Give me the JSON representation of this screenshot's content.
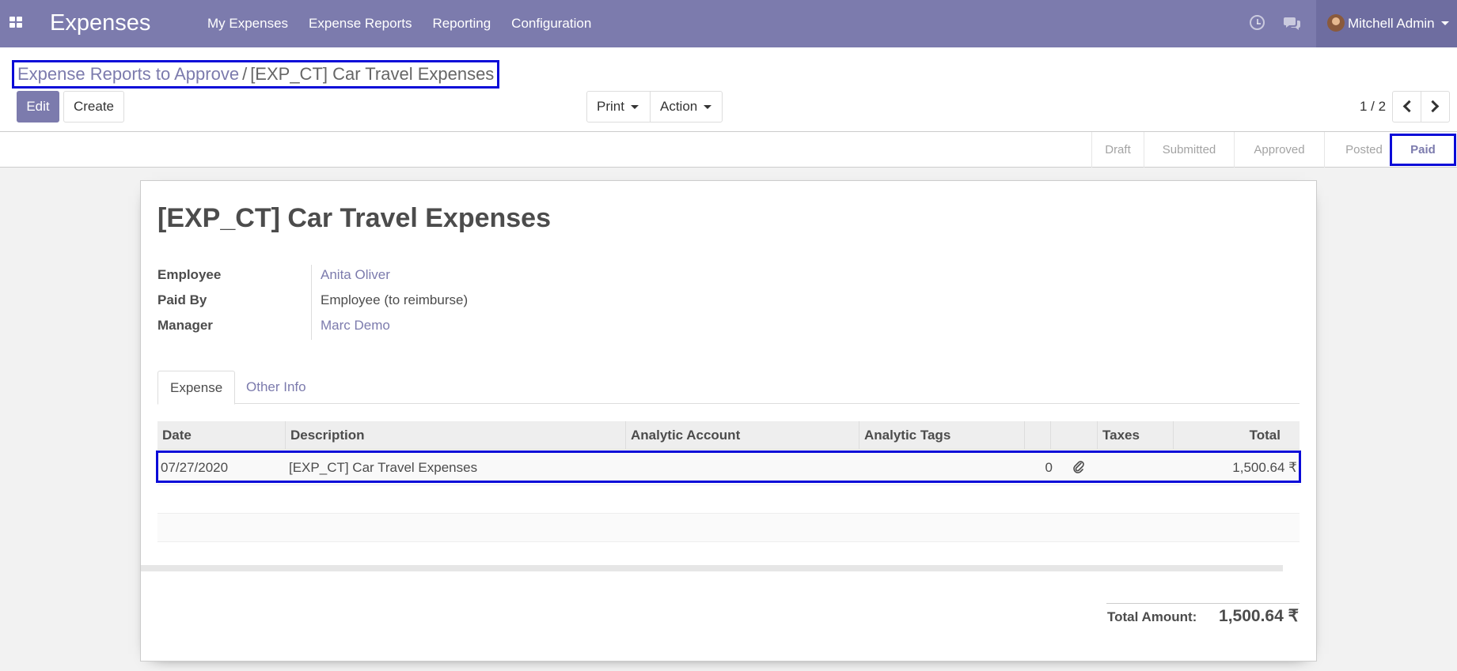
{
  "app": {
    "brand": "Expenses",
    "menu": [
      "My Expenses",
      "Expense Reports",
      "Reporting",
      "Configuration"
    ],
    "user": "Mitchell Admin",
    "accent_color": "#7c7bad"
  },
  "breadcrumb": {
    "parent": "Expense Reports to Approve",
    "separator": "/",
    "current": "[EXP_CT] Car Travel Expenses"
  },
  "buttons": {
    "edit": "Edit",
    "create": "Create",
    "print": "Print",
    "action": "Action"
  },
  "pager": {
    "text": "1 / 2"
  },
  "statusbar": {
    "stages": [
      "Draft",
      "Submitted",
      "Approved",
      "Posted",
      "Paid"
    ],
    "active": "Paid"
  },
  "form": {
    "title": "[EXP_CT] Car Travel Expenses",
    "fields": [
      {
        "label": "Employee",
        "value": "Anita Oliver"
      },
      {
        "label": "Paid By",
        "value": "Employee (to reimburse)"
      },
      {
        "label": "Manager",
        "value": "Marc Demo"
      }
    ],
    "tabs": [
      "Expense",
      "Other Info"
    ]
  },
  "table": {
    "headers": [
      "Date",
      "Description",
      "Analytic Account",
      "Analytic Tags",
      "",
      "Taxes",
      "Total"
    ],
    "rows": [
      {
        "date": "07/27/2020",
        "description": "[EXP_CT] Car Travel Expenses",
        "analytic_account": "",
        "analytic_tags": "",
        "attachments": "0",
        "taxes": "",
        "total": "1,500.64 ₹"
      }
    ]
  },
  "totals": {
    "label": "Total Amount:",
    "value": "1,500.64 ₹"
  }
}
